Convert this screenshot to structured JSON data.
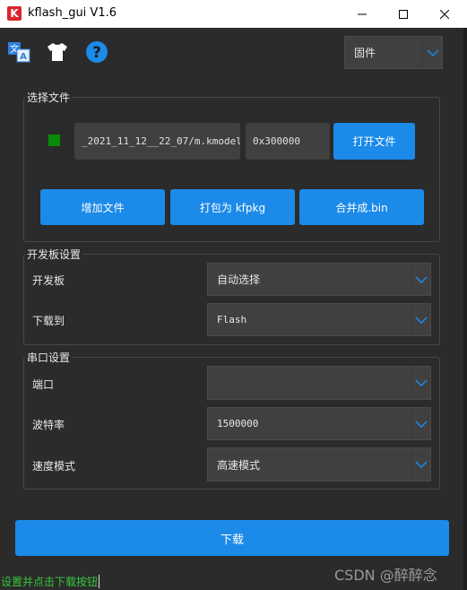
{
  "window": {
    "title": "kflash_gui V1.6",
    "app_icon_letter": "K",
    "minimize": "—",
    "maximize": "☐",
    "close": "✕"
  },
  "toolbar": {
    "icons": [
      "language-icon",
      "shirt-icon",
      "help-icon"
    ],
    "firmware_select": "固件"
  },
  "select_file": {
    "group_title": "选择文件",
    "status_color": "#0a8a0a",
    "file_path": "_2021_11_12__22_07/m.kmodel",
    "address": "0x300000",
    "open_file_button": "打开文件",
    "add_file_button": "增加文件",
    "pack_kfpkg_button": "打包为 kfpkg",
    "merge_bin_button": "合并成.bin"
  },
  "board_settings": {
    "group_title": "开发板设置",
    "board_label": "开发板",
    "board_value": "自动选择",
    "download_to_label": "下载到",
    "download_to_value": "Flash"
  },
  "serial_settings": {
    "group_title": "串口设置",
    "port_label": "端口",
    "port_value": "",
    "baud_label": "波特率",
    "baud_value": "1500000",
    "speed_mode_label": "速度模式",
    "speed_mode_value": "高速模式"
  },
  "download_button": "下载",
  "status_text": "设置并点击下载按钮",
  "watermark": "CSDN @醉醉念",
  "colors": {
    "accent": "#1b8ae8",
    "background": "#2b2b2b",
    "status_text": "#35c93a"
  }
}
